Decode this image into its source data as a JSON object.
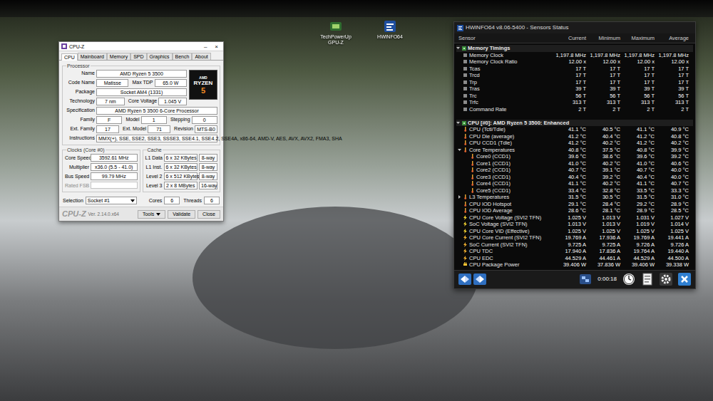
{
  "desktop": {
    "icons": [
      {
        "label": "TechPowerUp GPU-Z"
      },
      {
        "label": "HWiNFO64"
      }
    ]
  },
  "cpuz": {
    "title": "CPU-Z",
    "controls": [
      "–",
      "×"
    ],
    "tabs": [
      {
        "label": "CPU",
        "selected": true
      },
      {
        "label": "Mainboard",
        "selected": false
      },
      {
        "label": "Memory",
        "selected": false
      },
      {
        "label": "SPD",
        "selected": false
      },
      {
        "label": "Graphics",
        "selected": false
      },
      {
        "label": "Bench",
        "selected": false
      },
      {
        "label": "About",
        "selected": false
      }
    ],
    "logo": {
      "brand": "AMD",
      "name": "RYZEN",
      "tier": "5"
    },
    "processor": {
      "title": "Processor",
      "rows": [
        [
          {
            "label": "Name",
            "value": "AMD Ryzen 5 3500"
          }
        ],
        [
          {
            "label": "Code Name",
            "value": "Matisse"
          },
          {
            "label": "Max TDP",
            "value": "65.0 W"
          }
        ],
        [
          {
            "label": "Package",
            "value": "Socket AM4 (1331)"
          }
        ],
        [
          {
            "label": "Technology",
            "value": "7 nm"
          },
          {
            "label": "Core Voltage",
            "value": "1.045 V"
          }
        ],
        [
          {
            "label": "Specification",
            "value": "AMD Ryzen 5 3500 6-Core Processor"
          }
        ],
        [
          {
            "label": "Family",
            "value": "F"
          },
          {
            "label": "Model",
            "value": "1"
          },
          {
            "label": "Stepping",
            "value": "0"
          }
        ],
        [
          {
            "label": "Ext. Family",
            "value": "17"
          },
          {
            "label": "Ext. Model",
            "value": "71"
          },
          {
            "label": "Revision",
            "value": "MTS-B0"
          }
        ],
        [
          {
            "label": "Instructions",
            "value": "MMX(+), SSE, SSE2, SSE3, SSSE3, SSE4.1, SSE4.2, SSE4A, x86-64, AMD-V, AES, AVX, AVX2, FMA3, SHA"
          }
        ]
      ]
    },
    "clocks": {
      "title": "Clocks (Core #0)",
      "rows": [
        {
          "label": "Core Speed",
          "value": "3592.61 MHz",
          "disabled": false
        },
        {
          "label": "Multiplier",
          "value": "x36.0 (5.5 - 41.0)",
          "disabled": false
        },
        {
          "label": "Bus Speed",
          "value": "99.79 MHz",
          "disabled": false
        },
        {
          "label": "Rated FSB",
          "value": "",
          "disabled": true
        }
      ]
    },
    "cache": {
      "title": "Cache",
      "rows": [
        {
          "label": "L1 Data",
          "size": "6 x 32 KBytes",
          "ways": "8-way"
        },
        {
          "label": "L1 Inst.",
          "size": "6 x 32 KBytes",
          "ways": "8-way"
        },
        {
          "label": "Level 2",
          "size": "6 x 512 KBytes",
          "ways": "8-way"
        },
        {
          "label": "Level 3",
          "size": "2 x 8 MBytes",
          "ways": "16-way"
        }
      ]
    },
    "selection": {
      "label": "Selection",
      "value": "Socket #1",
      "cores_label": "Cores",
      "cores": "6",
      "threads_label": "Threads",
      "threads": "6"
    },
    "footer": {
      "brand": "CPU-Z",
      "version": "Ver. 2.14.0.x64",
      "buttons": [
        "Tools",
        "Validate",
        "Close"
      ]
    }
  },
  "hwinfo": {
    "title": "HWiNFO64 v8.06-5400 - Sensors Status",
    "columns": [
      "Sensor",
      "Current",
      "Minimum",
      "Maximum",
      "Average"
    ],
    "rows": [
      {
        "kind": "group",
        "label": "Memory Timings",
        "depth": 0,
        "expanded": true,
        "values": []
      },
      {
        "kind": "timing",
        "label": "Memory Clock",
        "depth": 1,
        "values": [
          "1,197.8 MHz",
          "1,197.8 MHz",
          "1,197.8 MHz",
          "1,197.8 MHz"
        ]
      },
      {
        "kind": "timing",
        "label": "Memory Clock Ratio",
        "depth": 1,
        "values": [
          "12.00 x",
          "12.00 x",
          "12.00 x",
          "12.00 x"
        ]
      },
      {
        "kind": "timing",
        "label": "Tcas",
        "depth": 1,
        "values": [
          "17 T",
          "17 T",
          "17 T",
          "17 T"
        ]
      },
      {
        "kind": "timing",
        "label": "Trcd",
        "depth": 1,
        "values": [
          "17 T",
          "17 T",
          "17 T",
          "17 T"
        ]
      },
      {
        "kind": "timing",
        "label": "Trp",
        "depth": 1,
        "values": [
          "17 T",
          "17 T",
          "17 T",
          "17 T"
        ]
      },
      {
        "kind": "timing",
        "label": "Tras",
        "depth": 1,
        "values": [
          "39 T",
          "39 T",
          "39 T",
          "39 T"
        ]
      },
      {
        "kind": "timing",
        "label": "Trc",
        "depth": 1,
        "values": [
          "56 T",
          "56 T",
          "56 T",
          "56 T"
        ]
      },
      {
        "kind": "timing",
        "label": "Trfc",
        "depth": 1,
        "values": [
          "313 T",
          "313 T",
          "313 T",
          "313 T"
        ]
      },
      {
        "kind": "timing",
        "label": "Command Rate",
        "depth": 1,
        "values": [
          "2 T",
          "2 T",
          "2 T",
          "2 T"
        ]
      },
      {
        "kind": "blank",
        "depth": 0,
        "values": []
      },
      {
        "kind": "group",
        "label": "CPU [#0]: AMD Ryzen 5 3500: Enhanced",
        "depth": 0,
        "expanded": true,
        "values": []
      },
      {
        "kind": "temp",
        "label": "CPU (Tctl/Tdie)",
        "depth": 1,
        "values": [
          "41.1 °C",
          "40.5 °C",
          "41.1 °C",
          "40.9 °C"
        ]
      },
      {
        "kind": "temp",
        "label": "CPU Die (average)",
        "depth": 1,
        "values": [
          "41.2 °C",
          "40.4 °C",
          "41.2 °C",
          "40.8 °C"
        ]
      },
      {
        "kind": "temp",
        "label": "CPU CCD1 (Tdie)",
        "depth": 1,
        "values": [
          "41.2 °C",
          "40.2 °C",
          "41.2 °C",
          "40.2 °C"
        ]
      },
      {
        "kind": "temp",
        "label": "Core Temperatures",
        "depth": 1,
        "expanded": true,
        "values": [
          "40.8 °C",
          "37.5 °C",
          "40.8 °C",
          "39.9 °C"
        ]
      },
      {
        "kind": "temp",
        "label": "Core0 (CCD1)",
        "depth": 2,
        "values": [
          "39.6 °C",
          "38.6 °C",
          "39.6 °C",
          "39.2 °C"
        ]
      },
      {
        "kind": "temp",
        "label": "Core1 (CCD1)",
        "depth": 2,
        "values": [
          "41.0 °C",
          "40.2 °C",
          "41.0 °C",
          "40.6 °C"
        ]
      },
      {
        "kind": "temp",
        "label": "Core2 (CCD1)",
        "depth": 2,
        "values": [
          "40.7 °C",
          "39.1 °C",
          "40.7 °C",
          "40.0 °C"
        ]
      },
      {
        "kind": "temp",
        "label": "Core3 (CCD1)",
        "depth": 2,
        "values": [
          "40.4 °C",
          "39.2 °C",
          "40.4 °C",
          "40.0 °C"
        ]
      },
      {
        "kind": "temp",
        "label": "Core4 (CCD1)",
        "depth": 2,
        "values": [
          "41.1 °C",
          "40.2 °C",
          "41.1 °C",
          "40.7 °C"
        ]
      },
      {
        "kind": "temp",
        "label": "Core5 (CCD1)",
        "depth": 2,
        "values": [
          "33.4 °C",
          "32.8 °C",
          "33.5 °C",
          "33.3 °C"
        ]
      },
      {
        "kind": "temp",
        "label": "L3 Temperatures",
        "depth": 1,
        "expanded": false,
        "values": [
          "31.5 °C",
          "30.5 °C",
          "31.5 °C",
          "31.0 °C"
        ]
      },
      {
        "kind": "temp",
        "label": "CPU IOD Hotspot",
        "depth": 1,
        "values": [
          "29.1 °C",
          "28.4 °C",
          "29.2 °C",
          "28.9 °C"
        ]
      },
      {
        "kind": "temp",
        "label": "CPU IOD Average",
        "depth": 1,
        "values": [
          "28.6 °C",
          "28.1 °C",
          "28.9 °C",
          "28.5 °C"
        ]
      },
      {
        "kind": "volt",
        "label": "CPU Core Voltage (SVI2 TFN)",
        "depth": 1,
        "values": [
          "1.025 V",
          "1.013 V",
          "1.031 V",
          "1.027 V"
        ]
      },
      {
        "kind": "volt",
        "label": "SoC Voltage (SVI2 TFN)",
        "depth": 1,
        "values": [
          "1.013 V",
          "1.013 V",
          "1.019 V",
          "1.014 V"
        ]
      },
      {
        "kind": "volt",
        "label": "CPU Core VID (Effective)",
        "depth": 1,
        "values": [
          "1.025 V",
          "1.025 V",
          "1.025 V",
          "1.025 V"
        ]
      },
      {
        "kind": "amp",
        "label": "CPU Core Current (SVI2 TFN)",
        "depth": 1,
        "values": [
          "19.769 A",
          "17.936 A",
          "19.769 A",
          "19.441 A"
        ]
      },
      {
        "kind": "amp",
        "label": "SoC Current (SVI2 TFN)",
        "depth": 1,
        "values": [
          "9.725 A",
          "9.725 A",
          "9.726 A",
          "9.726 A"
        ]
      },
      {
        "kind": "amp",
        "label": "CPU TDC",
        "depth": 1,
        "values": [
          "17.940 A",
          "17.836 A",
          "19.764 A",
          "19.440 A"
        ]
      },
      {
        "kind": "amp",
        "label": "CPU EDC",
        "depth": 1,
        "values": [
          "44.529 A",
          "44.461 A",
          "44.529 A",
          "44.500 A"
        ]
      },
      {
        "kind": "power",
        "label": "CPU Package Power",
        "depth": 1,
        "values": [
          "39.406 W",
          "37.836 W",
          "39.406 W",
          "39.338 W"
        ]
      }
    ],
    "footer": {
      "time": "0:00:18"
    }
  }
}
